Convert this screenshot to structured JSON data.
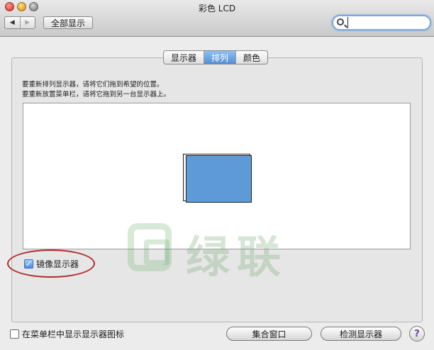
{
  "window": {
    "title": "彩色 LCD"
  },
  "toolbar": {
    "back_glyph": "◀",
    "forward_glyph": "▶",
    "show_all_label": "全部显示",
    "search": {
      "value": "",
      "placeholder": ""
    }
  },
  "tabs": [
    {
      "label": "显示器",
      "active": false
    },
    {
      "label": "排列",
      "active": true
    },
    {
      "label": "颜色",
      "active": false
    }
  ],
  "instructions": {
    "line1": "要重新排列显示器，请将它们拖到希望的位置。",
    "line2": "要重新放置菜单栏，请将它拖到另一台显示器上。"
  },
  "watermark": {
    "text": "绿联"
  },
  "mirror": {
    "label": "镜像显示器",
    "checked": true,
    "check_glyph": "✓"
  },
  "bottom": {
    "show_in_menubar_label": "在菜单栏中显示显示器图标",
    "show_in_menubar_checked": false,
    "gather_windows_label": "集合窗口",
    "detect_displays_label": "检测显示器",
    "help_glyph": "?"
  },
  "colors": {
    "display_blue": "#5d9ad7",
    "active_tab": "#4f8fd8",
    "highlight_ellipse": "#b22a2a"
  },
  "icons": {
    "close": "close-button-icon",
    "minimize": "minimize-button-icon",
    "zoom": "zoom-button-icon",
    "search": "search-icon",
    "help": "help-icon"
  }
}
